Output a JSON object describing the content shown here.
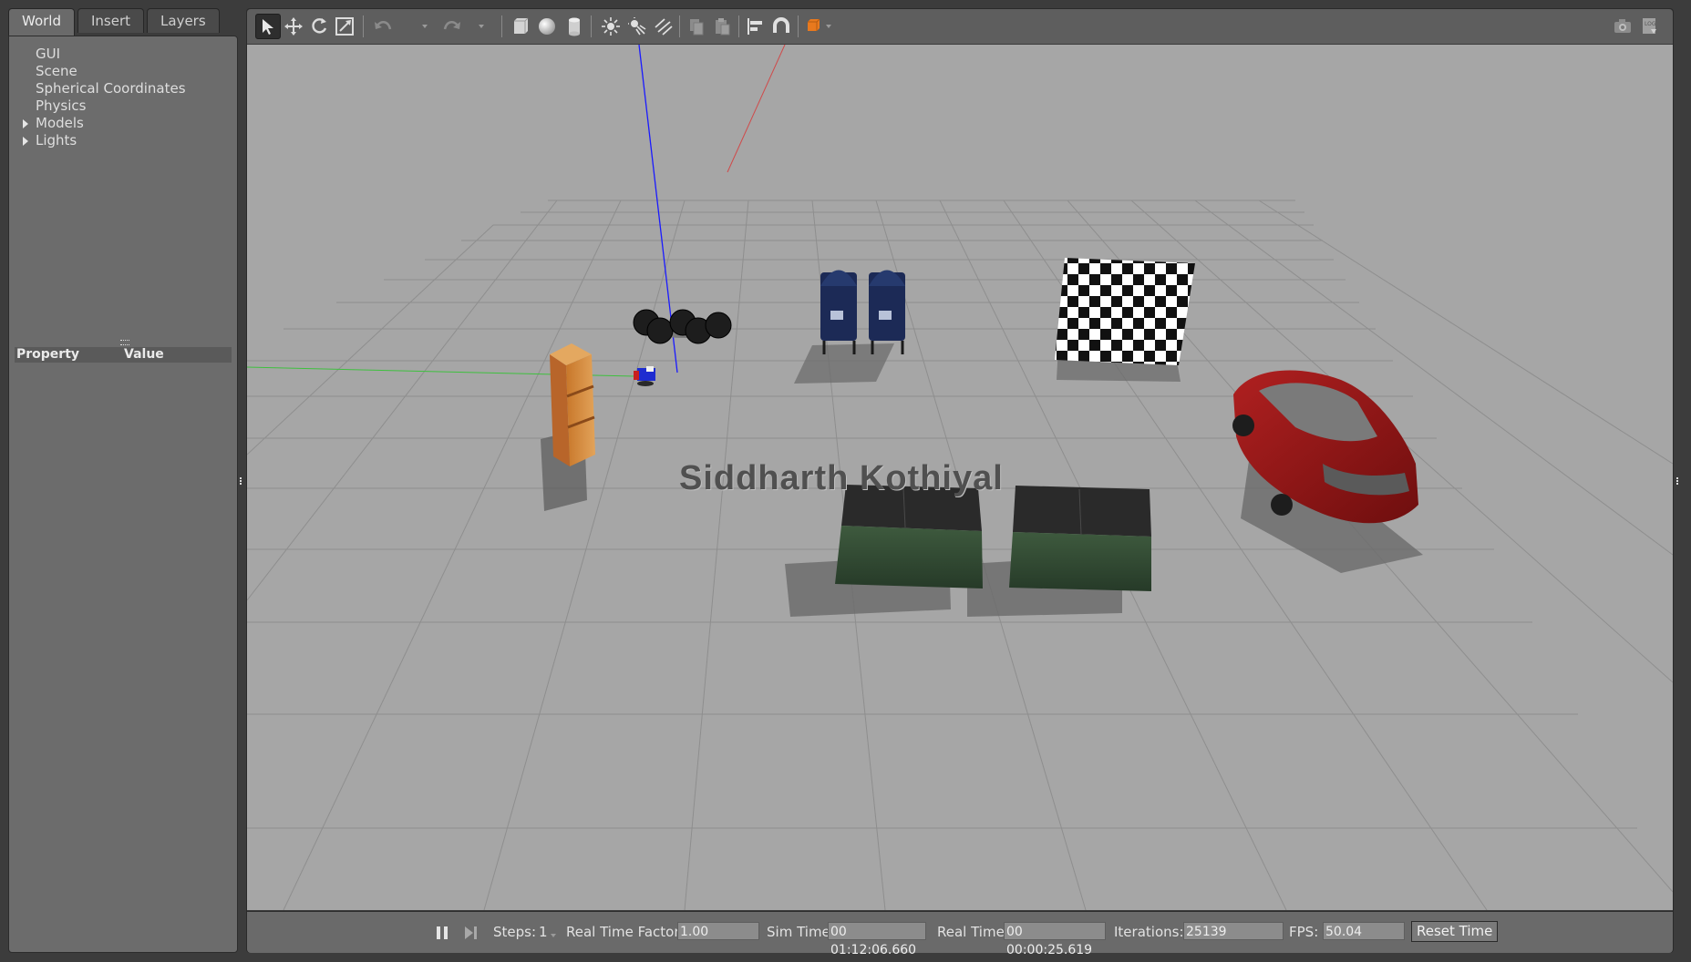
{
  "left_panel": {
    "tabs": [
      {
        "label": "World",
        "active": true
      },
      {
        "label": "Insert",
        "active": false
      },
      {
        "label": "Layers",
        "active": false
      }
    ],
    "tree": [
      {
        "label": "GUI",
        "expandable": false
      },
      {
        "label": "Scene",
        "expandable": false
      },
      {
        "label": "Spherical Coordinates",
        "expandable": false
      },
      {
        "label": "Physics",
        "expandable": false
      },
      {
        "label": "Models",
        "expandable": true
      },
      {
        "label": "Lights",
        "expandable": true
      }
    ],
    "property_table": {
      "col_property": "Property",
      "col_value": "Value"
    }
  },
  "toolbar": {
    "tools": [
      "select-arrow-icon",
      "translate-icon",
      "rotate-icon",
      "scale-icon",
      "undo-icon",
      "redo-icon",
      "box-icon",
      "sphere-icon",
      "cylinder-icon",
      "point-light-icon",
      "spot-light-icon",
      "directional-light-icon",
      "copy-icon",
      "paste-icon",
      "align-icon",
      "snap-magnet-icon",
      "view-angle-cube-icon",
      "screenshot-camera-icon",
      "log-icon"
    ]
  },
  "viewport": {
    "overlay_text": "Siddharth Kothiyal",
    "background_color": "#a6a6a6",
    "objects": [
      "blue-robot",
      "black-tires",
      "bookshelf",
      "mailboxes",
      "checkerboard",
      "red-car",
      "dumpsters"
    ]
  },
  "statusbar": {
    "steps_label": "Steps:",
    "steps_value": "1",
    "rtf_label": "Real Time Factor:",
    "rtf_value": "1.00",
    "sim_time_label": "Sim Time:",
    "sim_time_value": "00 01:12:06.660",
    "real_time_label": "Real Time:",
    "real_time_value": "00 00:00:25.619",
    "iterations_label": "Iterations:",
    "iterations_value": "25139",
    "fps_label": "FPS:",
    "fps_value": "50.04",
    "reset_time_label": "Reset Time"
  },
  "colors": {
    "accent_orange": "#e8791e",
    "panel_bg": "#6c6c6c",
    "window_bg": "#3c3c3c"
  }
}
